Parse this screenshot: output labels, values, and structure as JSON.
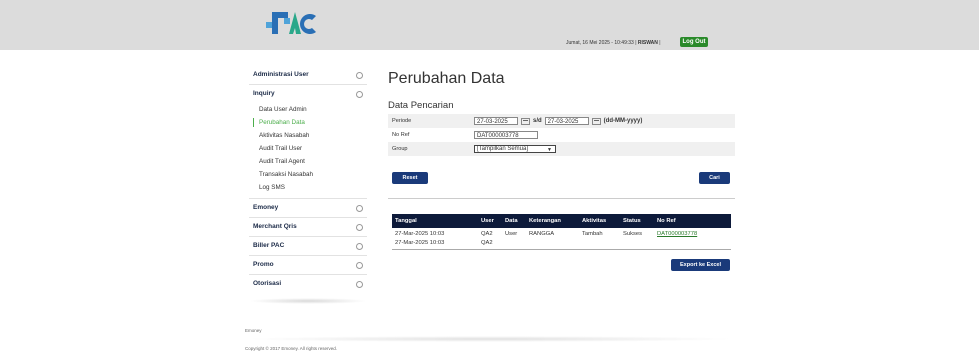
{
  "header": {
    "logo_text": "PAC",
    "datetime": "Jumat, 16 Mei 2025 - 10:49:33",
    "user": "RISWAN",
    "logout_label": "Log Out"
  },
  "sidebar": {
    "groups": [
      {
        "label": "Administrasi User"
      },
      {
        "label": "Inquiry",
        "items": [
          "Data User Admin",
          "Perubahan Data",
          "Aktivitas Nasabah",
          "Audit Trail User",
          "Audit Trail Agent",
          "Transaksi Nasabah",
          "Log SMS"
        ]
      },
      {
        "label": "Emoney"
      },
      {
        "label": "Merchant Qris"
      },
      {
        "label": "Biller PAC"
      },
      {
        "label": "Promo"
      },
      {
        "label": "Otorisasi"
      }
    ]
  },
  "main": {
    "title": "Perubahan Data",
    "section": "Data Pencarian",
    "form": {
      "periode_label": "Periode",
      "date_from": "27-03-2025",
      "sd": "s/d",
      "date_to": "27-03-2025",
      "date_format": "(dd-MM-yyyy)",
      "noref_label": "No Ref",
      "noref_value": "DAT000003778",
      "group_label": "Group",
      "group_value": "[Tampilkan Semua]"
    },
    "reset_label": "Reset",
    "cari_label": "Cari",
    "table": {
      "headers": [
        "Tanggal",
        "User",
        "Data",
        "Keterangan",
        "Aktivitas",
        "Status",
        "No Ref"
      ],
      "rows": [
        [
          "27-Mar-2025 10:03",
          "QA2",
          "User",
          "RANGGA",
          "Tambah",
          "Sukses",
          "DAT000003778"
        ],
        [
          "27-Mar-2025 10:03",
          "QA2",
          "",
          "",
          "",
          "",
          ""
        ]
      ]
    },
    "export_label": "Export ke Excel"
  },
  "footer": {
    "brand": "Emoney",
    "copyright": "Copyright © 2017 Emoney. All rights reserved."
  }
}
